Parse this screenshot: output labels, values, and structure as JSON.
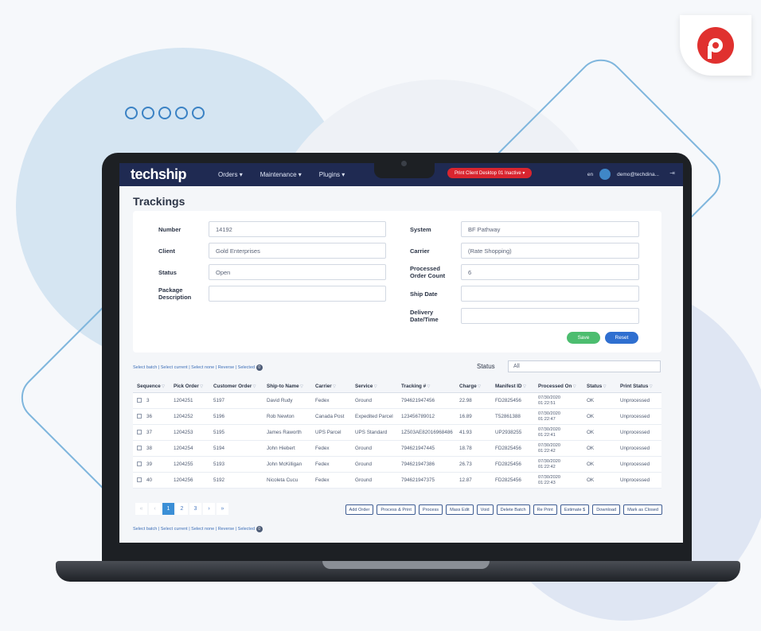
{
  "brand_badge": {
    "icon": "p-logo-icon",
    "color": "#e0312f"
  },
  "app": {
    "brand": "techship",
    "nav": [
      "Orders",
      "Maintenance",
      "Plugins"
    ],
    "print_client": "Print Client Desktop 01 Inactive",
    "lang": "en",
    "user": "demo@techdina...",
    "accent": "#1f2a52"
  },
  "page": {
    "title": "Trackings"
  },
  "form": {
    "number_label": "Number",
    "number_value": "14192",
    "client_label": "Client",
    "client_value": "Gold Enterprises",
    "status_label": "Status",
    "status_value": "Open",
    "package_label_1": "Package",
    "package_label_2": "Description",
    "package_value": "",
    "system_label": "System",
    "system_value": "BF Pathway",
    "carrier_label": "Carrier",
    "carrier_value": "(Rate Shopping)",
    "processed_label_1": "Processed",
    "processed_label_2": "Order Count",
    "processed_value": "6",
    "ship_date_label": "Ship Date",
    "ship_date_value": "",
    "delivery_label_1": "Delivery",
    "delivery_label_2": "Date/Time",
    "delivery_value": "",
    "save": "Save",
    "reset": "Reset"
  },
  "batch": {
    "text": "Select batch | Select current | Select none | Reverse | Selected",
    "count": "0"
  },
  "filter": {
    "status_label": "Status",
    "status_value": "All"
  },
  "table": {
    "headers": [
      "Sequence",
      "Pick Order",
      "Customer Order",
      "Ship-to Name",
      "Carrier",
      "Service",
      "Tracking #",
      "Charge",
      "Manifest ID",
      "Processed On",
      "Status",
      "Print Status"
    ],
    "rows": [
      [
        "3",
        "1204251",
        "5197",
        "David Rudy",
        "Fedex",
        "Ground",
        "794621947456",
        "22.98",
        "FD2825456",
        "07/30/2020",
        "01:22:51",
        "OK",
        "Unprocessed"
      ],
      [
        "36",
        "1204252",
        "5196",
        "Rob Newton",
        "Canada Post",
        "Expedited Parcel",
        "123456789012",
        "16.89",
        "T52861388",
        "07/30/2020",
        "01:22:47",
        "OK",
        "Unprocessed"
      ],
      [
        "37",
        "1204253",
        "5195",
        "James Raworth",
        "UPS Parcel",
        "UPS Standard",
        "1Z503AE82016968486",
        "41.93",
        "UP2938255",
        "07/30/2020",
        "01:22:41",
        "OK",
        "Unprocessed"
      ],
      [
        "38",
        "1204254",
        "5194",
        "John Hiebert",
        "Fedex",
        "Ground",
        "794621947445",
        "18.78",
        "FD2825456",
        "07/30/2020",
        "01:22:42",
        "OK",
        "Unprocessed"
      ],
      [
        "39",
        "1204255",
        "5193",
        "John McKilligan",
        "Fedex",
        "Ground",
        "794621947386",
        "26.73",
        "FD2825456",
        "07/30/2020",
        "01:22:42",
        "OK",
        "Unprocessed"
      ],
      [
        "40",
        "1204256",
        "5192",
        "Nicoleta Cucu",
        "Fedex",
        "Ground",
        "794621947375",
        "12.87",
        "FD2825456",
        "07/30/2020",
        "01:22:43",
        "OK",
        "Unprocessed"
      ]
    ]
  },
  "pager": {
    "first": "«",
    "prev": "‹",
    "pages": [
      "1",
      "2",
      "3"
    ],
    "next": "›",
    "last": "»",
    "current": "1"
  },
  "actions": [
    "Add Order",
    "Process & Print",
    "Process",
    "Mass Edit",
    "Void",
    "Delete Batch",
    "Re Print",
    "Estimate $",
    "Download",
    "Mark as Closed"
  ]
}
